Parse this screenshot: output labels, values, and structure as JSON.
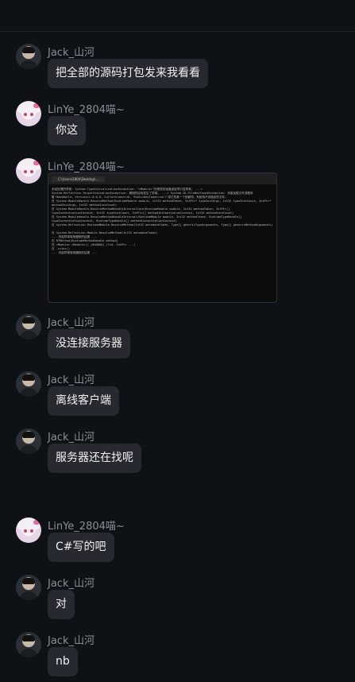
{
  "messages": [
    {
      "sender": "Jack_山河",
      "text": "把全部的源码打包发来我看看"
    },
    {
      "sender": "LinYe_2804喵~",
      "text": "你这"
    },
    {
      "sender": "LinYe_2804喵~",
      "image": {
        "tab": "C:\\Users\\2804\\Desktop\\...",
        "lines": [
          "未经处理的异常:  System.TypeInitializationException: \"<Module>\"的类型初始值设定项引发异常。 ---> System.Reflection.TargetInvocationException: 调用的目标发生了异常。 ---> System.IO.FileNotFoundException: 未能加载文件或程序集\"HackWorld, Version=1.0.0.0, Culture=neutral, PublicKeyToken=null\"或它的某一个依赖项。系统找不到指定的文件。",
          "   在 System.ModuleHandle.ResolveMethod(RuntimeModule module, Int32 methodToken, IntPtr* typeInstArgs, Int32 typeInstCount, IntPtr* methodInstArgs, Int32 methodInstCount)",
          "   在 System.ModuleHandle.ResolveMethodHandleInternalCore(RuntimeModule module, Int32 methodToken, IntPtr[] typeInstantiationContext, Int32 typeInstCount, IntPtr[] methodInstantiationContext, Int32 methodInstCount)",
          "   在 System.ModuleHandle.ResolveMethodHandleInternal(RuntimeModule module, Int32 methodToken, RuntimeTypeHandle[] typeInstantiationContext, RuntimeTypeHandle[] methodInstantiationContext)",
          "   在 System.Reflection.RuntimeModule.ResolveMethod(Int32 metadataToken, Type[] genericTypeArguments, Type[] genericMethodArguments)",
          "   在 System.Reflection.Module.ResolveMethod(Int32 metadataToken)",
          "   --- 内部异常堆栈跟踪的结尾 ---",
          "   在 RTMethod(RuntimeMethodHandle method)",
          "   在 <Module>.<Module>() [0x0000] (ltd, IntPtr ...)",
          "   在 .cctor()",
          "   --- 内部异常堆栈跟踪的结尾 ---"
        ]
      }
    },
    {
      "sender": "Jack_山河",
      "text": "没连接服务器"
    },
    {
      "sender": "Jack_山河",
      "text": "离线客户端"
    },
    {
      "sender": "Jack_山河",
      "text": "服务器还在找呢"
    },
    {
      "sender": "LinYe_2804喵~",
      "text": "C#写的吧"
    },
    {
      "sender": "Jack_山河",
      "text": "对"
    },
    {
      "sender": "Jack_山河",
      "text": "nb"
    }
  ]
}
